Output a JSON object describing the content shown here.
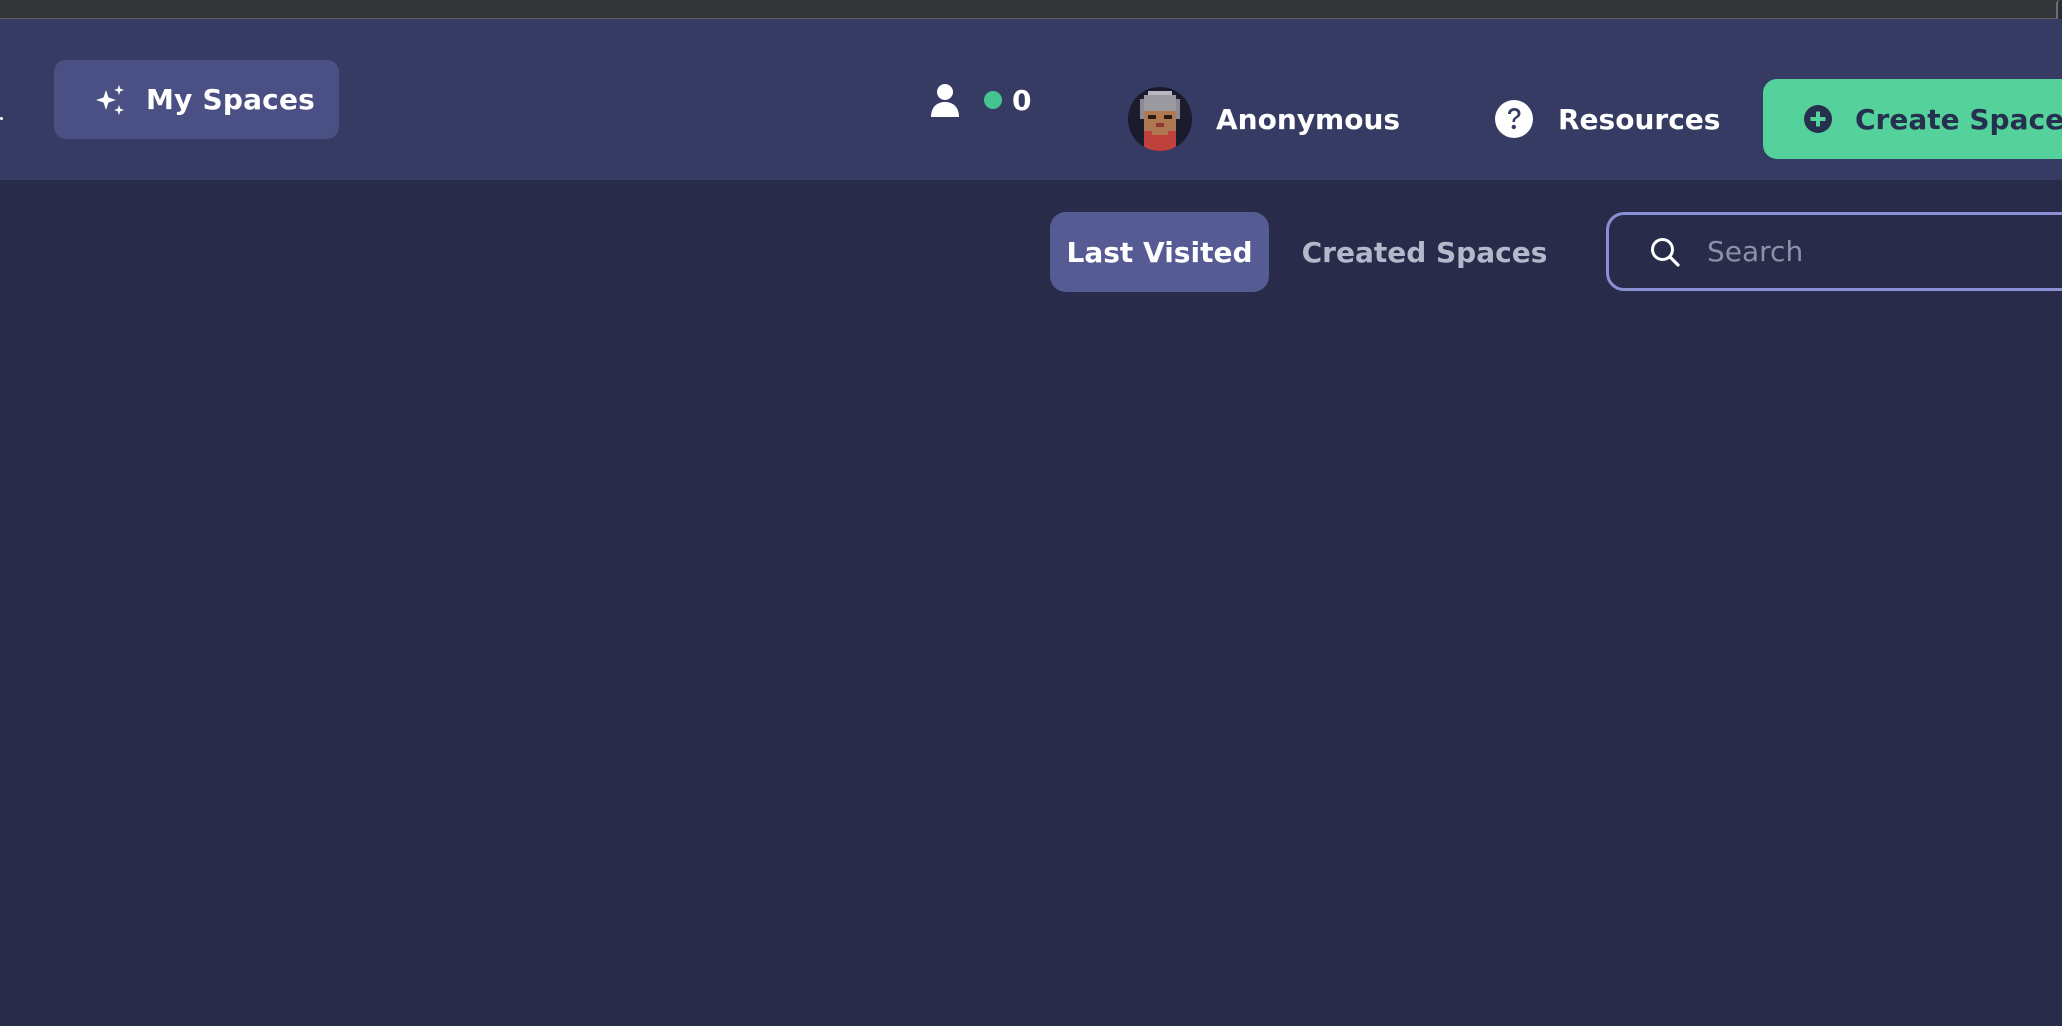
{
  "header": {
    "my_spaces_label": "My Spaces",
    "online_count": "0",
    "profile_name": "Anonymous",
    "resources_label": "Resources",
    "create_space_label": "Create Space"
  },
  "tabs": [
    {
      "label": "Last Visited",
      "active": true
    },
    {
      "label": "Created Spaces",
      "active": false
    }
  ],
  "search": {
    "placeholder": "Search",
    "value": ""
  },
  "icons": {
    "my_spaces": "sparkles-icon",
    "online": "person-icon",
    "status": "status-dot",
    "profile": "avatar",
    "resources": "question-circle-icon",
    "create_space": "plus-circle-icon",
    "search": "search-icon"
  },
  "colors": {
    "background": "#282c4a",
    "header": "#363b63",
    "my_spaces_button": "#4a5083",
    "active_tab": "#565b94",
    "create_button": "#55d29b",
    "online_dot": "#44c491",
    "search_border": "#8b90d4"
  }
}
